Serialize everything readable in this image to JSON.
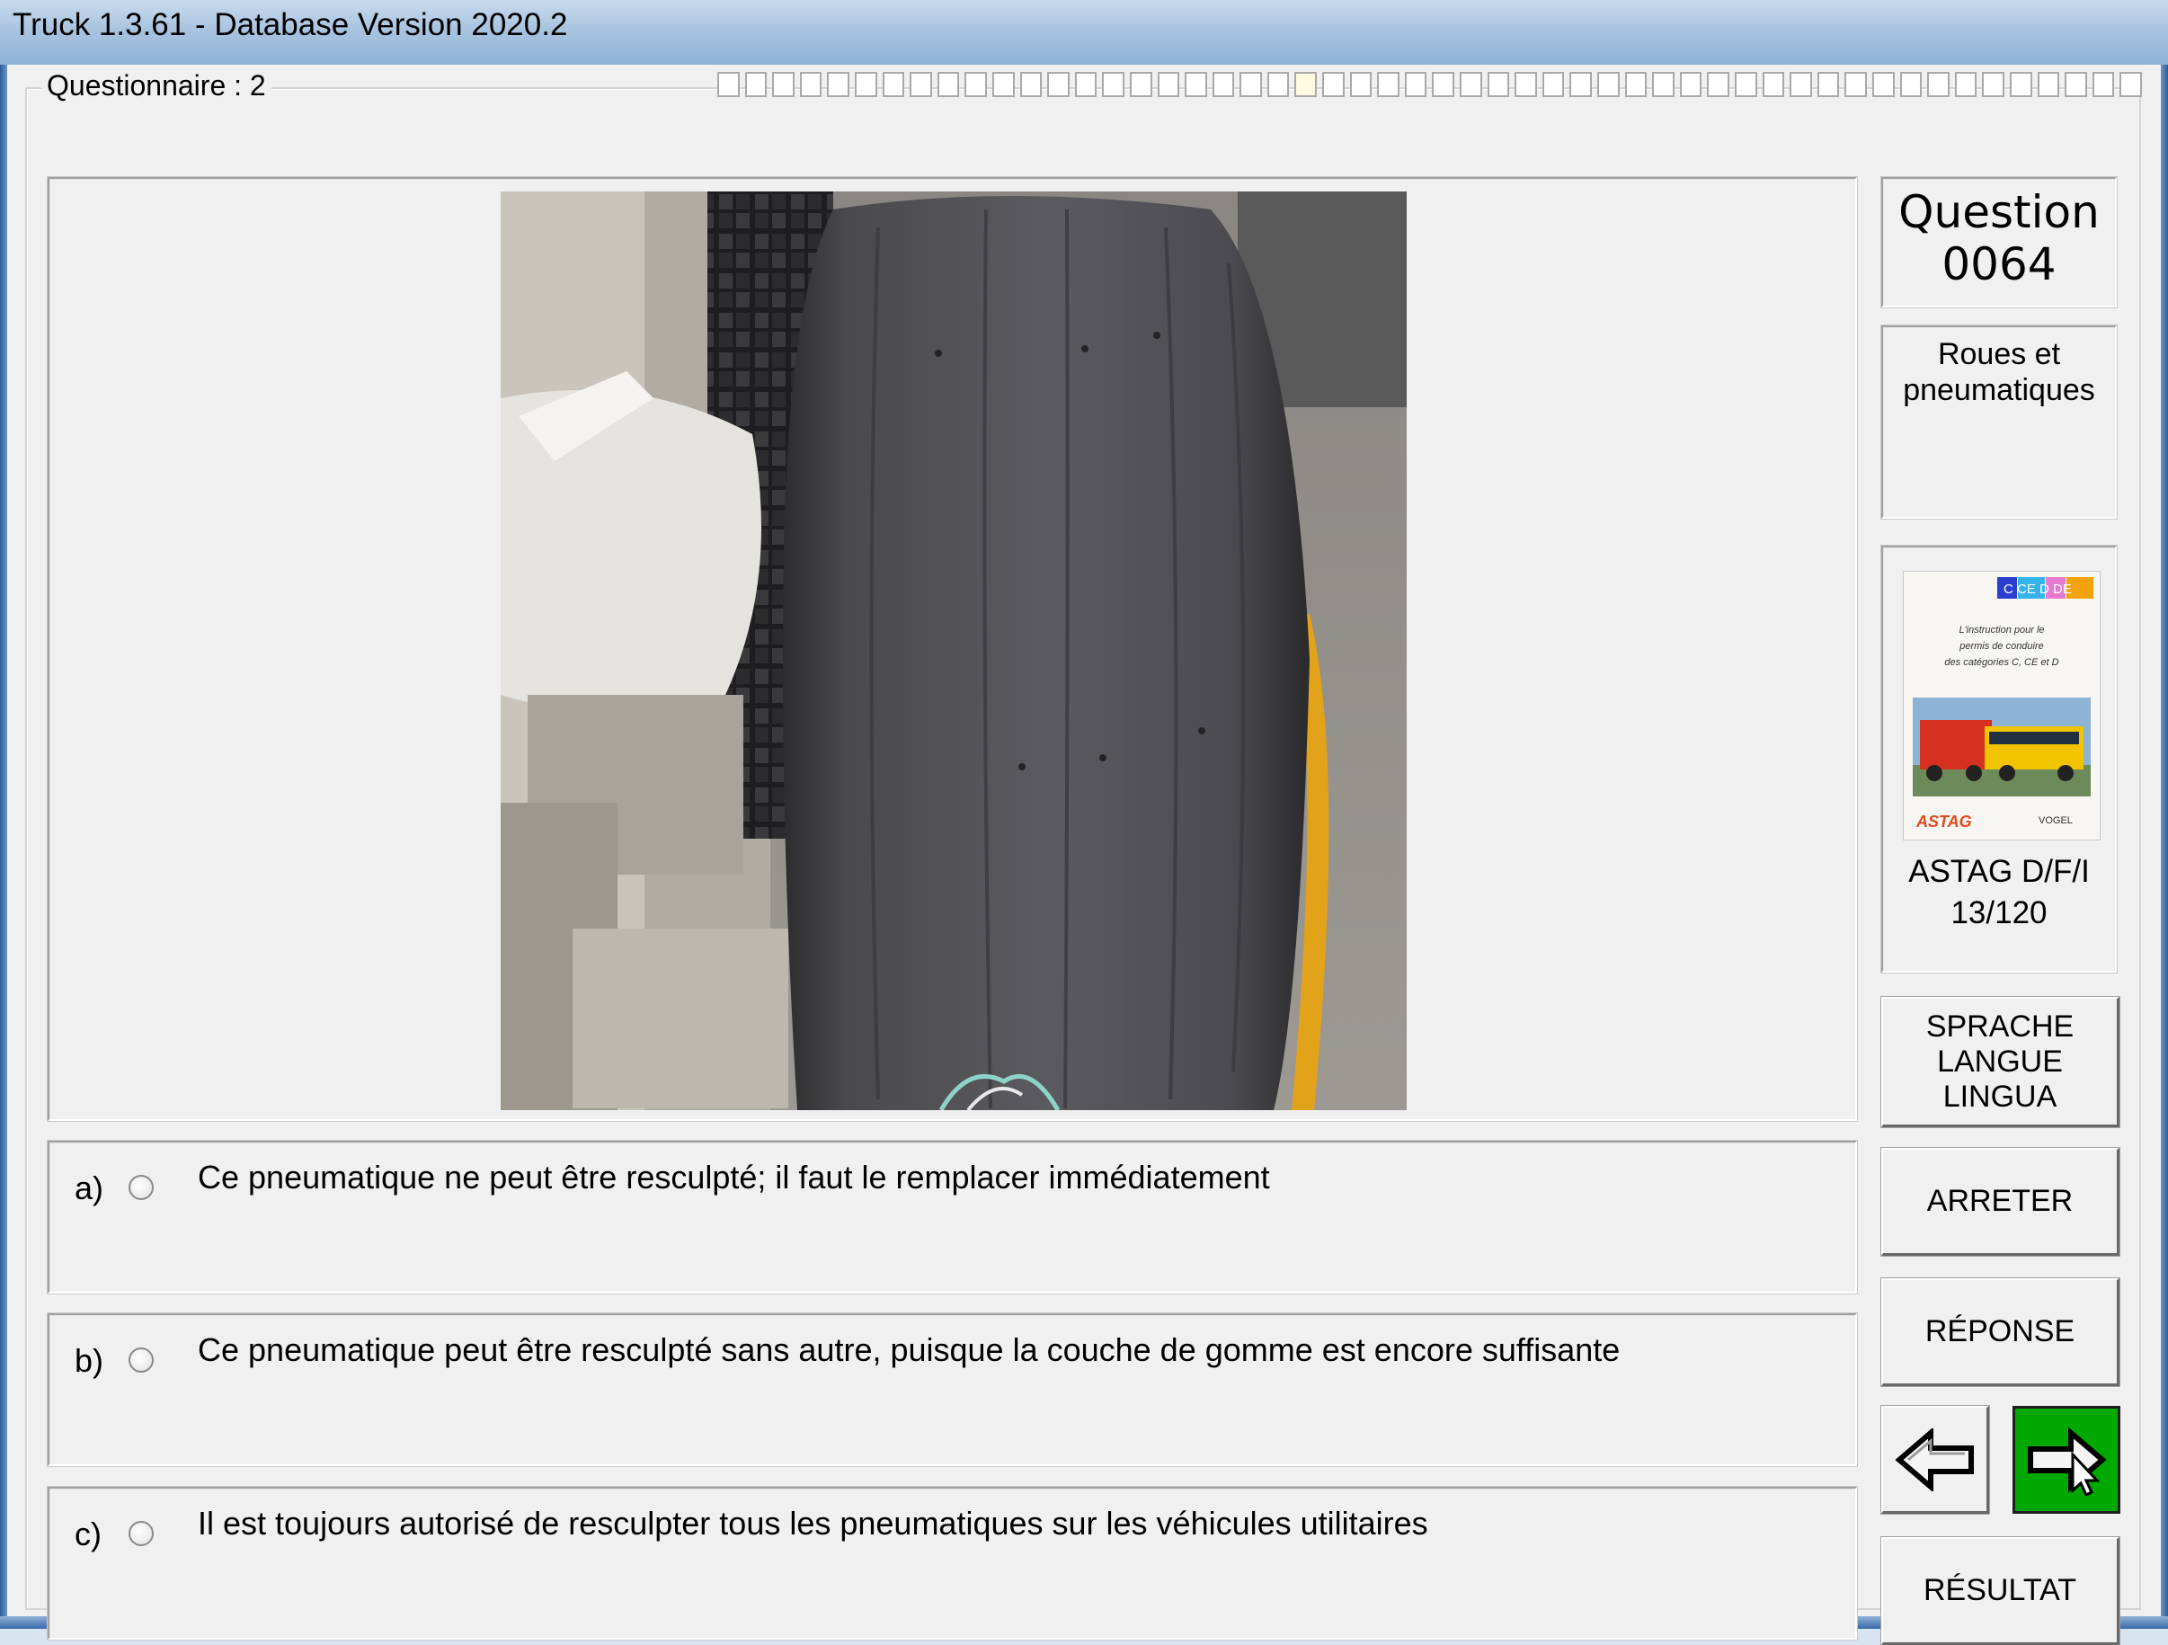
{
  "window": {
    "title": "Truck 1.3.61 - Database Version 2020.2"
  },
  "questionnaire": {
    "label": "Questionnaire : 2",
    "progress_total": 52,
    "progress_current": 22
  },
  "question": {
    "label": "Question",
    "number": "0064",
    "category": "Roues et pneumatiques",
    "image_icon": "worn-tire-photo"
  },
  "answers": [
    {
      "letter": "a)",
      "text": "Ce pneumatique ne peut être resculpté; il faut le remplacer immédiatement"
    },
    {
      "letter": "b)",
      "text": "Ce pneumatique peut être resculpté sans autre, puisque la couche de gomme est encore suffisante"
    },
    {
      "letter": "c)",
      "text": "Il est toujours autorisé de resculpter tous les pneumatiques sur les véhicules utilitaires"
    }
  ],
  "book": {
    "badge": "C CE D DE",
    "cover_text": "L'instruction pour le permis de conduire des catégories C, CE et D",
    "publisher_left": "ASTAG",
    "publisher_right": "VOGEL",
    "caption_line1": "ASTAG D/F/I",
    "caption_line2": "13/120"
  },
  "buttons": {
    "language_line1": "SPRACHE",
    "language_line2": "LANGUE",
    "language_line3": "LINGUA",
    "stop": "ARRETER",
    "answer": "RÉPONSE",
    "back_icon": "left-arrow-icon",
    "next_icon": "right-arrow-cursor-icon",
    "result": "RÉSULTAT"
  },
  "colors": {
    "next_button": "#00a800",
    "title_bar": "#a9c4e0"
  }
}
